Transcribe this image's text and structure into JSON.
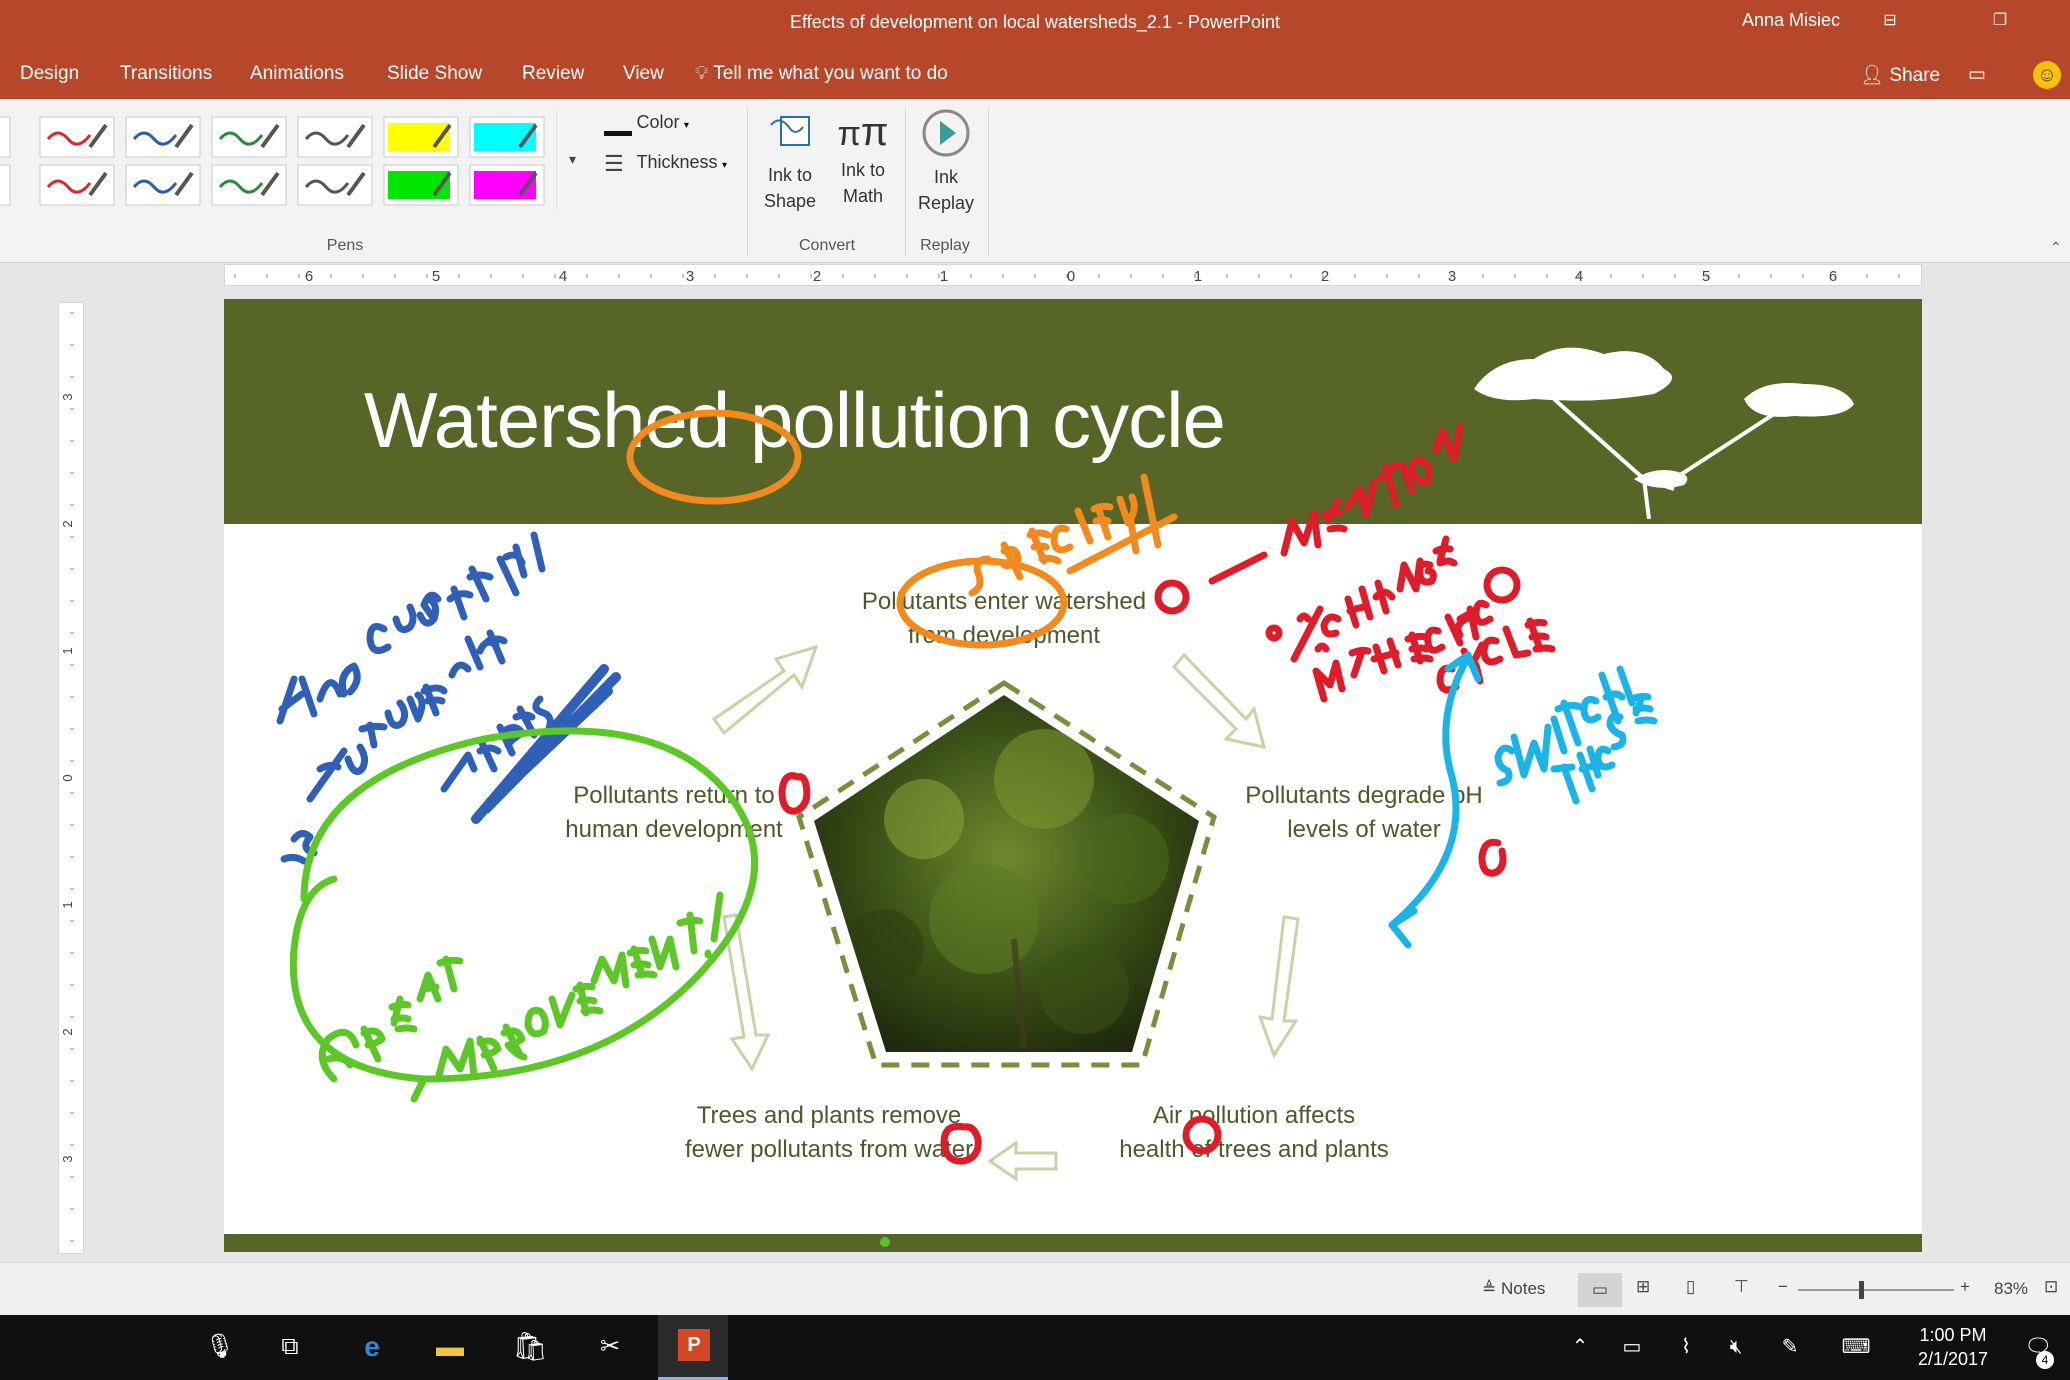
{
  "window": {
    "title": "Effects of development on local watersheds_2.1  -  PowerPoint",
    "user": "Anna Misiec"
  },
  "tabs": [
    "Design",
    "Transitions",
    "Animations",
    "Slide Show",
    "Review",
    "View"
  ],
  "tell_me": "Tell me what you want to do",
  "share_label": "Share",
  "ribbon": {
    "pens_group": "Pens",
    "color_label": "Color",
    "thickness_label": "Thickness",
    "ink_to_shape": [
      "Ink to",
      "Shape"
    ],
    "ink_to_math": [
      "Ink to",
      "Math"
    ],
    "ink_replay": [
      "Ink",
      "Replay"
    ],
    "convert_group": "Convert",
    "replay_group": "Replay",
    "pen_colors_row1": [
      "#d42b2b",
      "#2a5cb0",
      "#2b8a3e",
      "#555555",
      "#ffff00",
      "#00ffff"
    ],
    "pen_colors_row2": [
      "#d42b2b",
      "#2a5cb0",
      "#2b8a3e",
      "#555555",
      "#00e600",
      "#ff00ff"
    ]
  },
  "ruler": {
    "top_labels": [
      "6",
      "5",
      "4",
      "3",
      "2",
      "1",
      "0",
      "1",
      "2",
      "3",
      "4",
      "5",
      "6"
    ],
    "left_labels": [
      "3",
      "2",
      "1",
      "0",
      "1",
      "2",
      "3"
    ]
  },
  "slide": {
    "title": "Watershed pollution cycle",
    "cycle": {
      "top": [
        "Pollutants enter watershed",
        "from development"
      ],
      "right": [
        "Pollutants degrade pH",
        "levels of water"
      ],
      "bottom_right": [
        "Air pollution affects",
        "health of trees and plants"
      ],
      "bottom_left": [
        "Trees and plants remove",
        "fewer pollutants from water"
      ],
      "left": [
        "Pollutants return to",
        "human development"
      ]
    },
    "colors": {
      "header": "#576627",
      "text": "#4d5a27"
    }
  },
  "status": {
    "notes_label": "Notes",
    "zoom": "83%"
  },
  "taskbar": {
    "time": "1:00 PM",
    "date": "2/1/2017",
    "notification_count": "4"
  }
}
